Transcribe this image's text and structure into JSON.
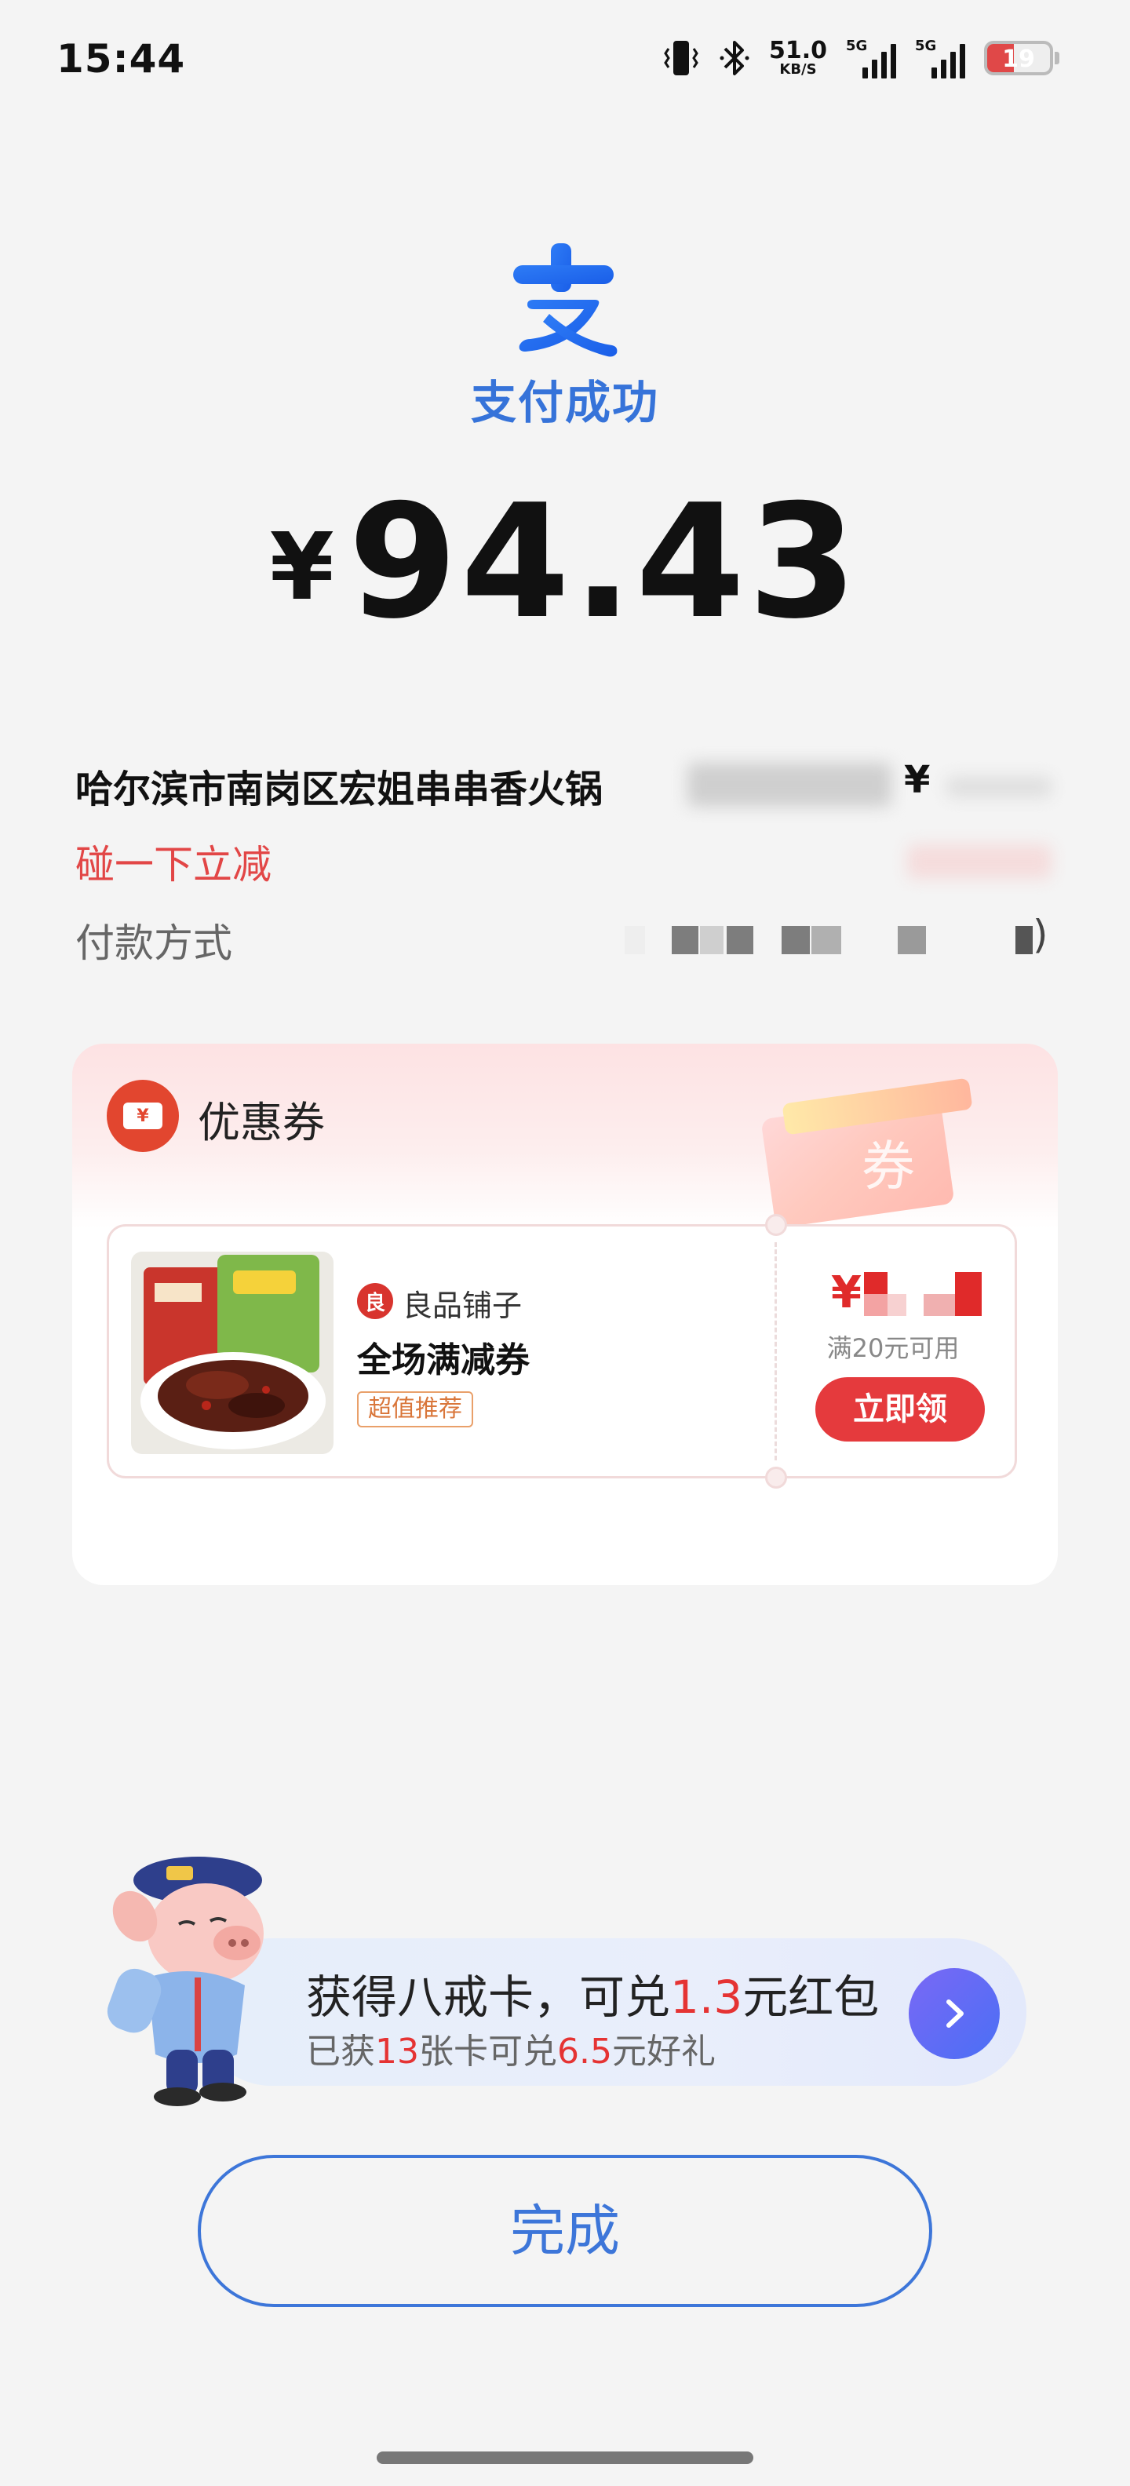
{
  "status_bar": {
    "time": "15:44",
    "net_speed_value": "51.0",
    "net_speed_unit": "KB/S",
    "signal1_label": "5G",
    "signal2_label": "5G",
    "battery": "19",
    "icons": [
      "vibrate-icon",
      "bluetooth-icon",
      "signal-icon",
      "signal-icon",
      "battery-icon"
    ]
  },
  "header": {
    "logo_icon": "alipay-logo",
    "success_text": "支付成功",
    "currency_symbol": "¥",
    "amount": "94.43"
  },
  "details": {
    "merchant_name": "哈尔滨市南岗区宏姐串串香火锅",
    "merchant_amount_symbol": "¥",
    "discount_label": "碰一下立减",
    "payment_method_label": "付款方式",
    "payment_method_tail": ")"
  },
  "coupon": {
    "section_title": "优惠券",
    "header_icon_char": "¥",
    "deco_text": "券",
    "brand_icon_char": "良",
    "brand_name": "良品铺子",
    "coupon_name": "全场满减券",
    "tag": "超值推荐",
    "value_symbol": "¥",
    "condition": "满20元可用",
    "claim_button": "立即领"
  },
  "bajie": {
    "line1_prefix": "获得八戒卡，可兑",
    "line1_amount": "1.3",
    "line1_suffix": "元红包",
    "line2_prefix": "已获",
    "line2_count": "13",
    "line2_mid": "张卡可兑",
    "line2_amount": "6.5",
    "line2_suffix": "元好礼"
  },
  "actions": {
    "done_label": "完成"
  },
  "colors": {
    "brand_blue": "#3673d9",
    "discount_red": "#e24646",
    "claim_red": "#e53a3d",
    "page_bg": "#f4f4f4"
  }
}
